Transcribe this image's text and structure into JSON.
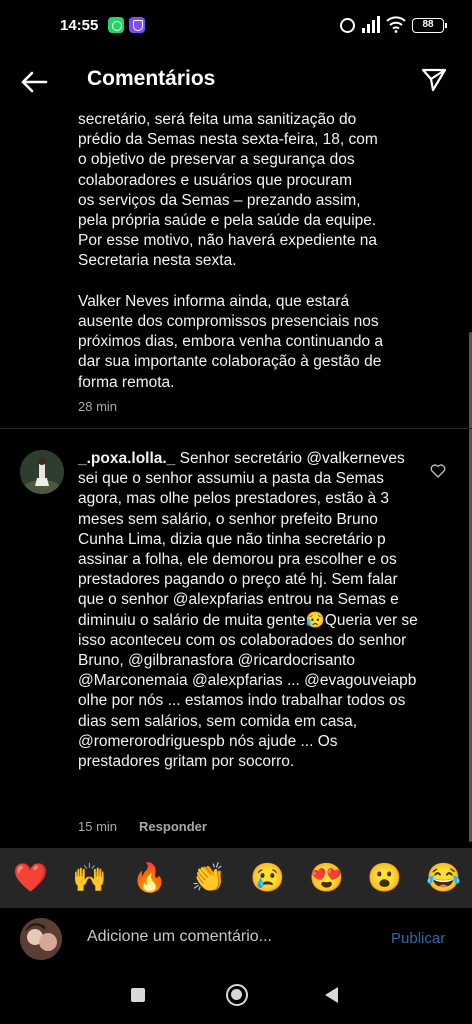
{
  "status_bar": {
    "time": "14:55",
    "battery": "88",
    "icons": [
      "whatsapp-icon",
      "vpn-icon",
      "alarm-icon",
      "signal-icon",
      "wifi-icon",
      "battery-icon"
    ]
  },
  "header": {
    "title": "Comentários",
    "back_icon": "arrow-left-icon",
    "share_icon": "paper-plane-icon"
  },
  "caption": {
    "text": "secretário, será feita uma sanitização do\nprédio da Semas nesta sexta-feira, 18, com\no objetivo de preservar a segurança dos\ncolaboradores e usuários que procuram\nos serviços da Semas – prezando assim,\npela própria saúde e pela saúde da equipe.\nPor esse motivo, não haverá expediente na\nSecretaria nesta sexta.\n\nValker Neves informa ainda, que estará\nausente dos compromissos presenciais nos\npróximos dias, embora venha continuando a\ndar sua importante colaboração à gestão de\nforma remota.",
    "time": "28 min"
  },
  "comment": {
    "username": "_.poxa.lolla._",
    "text": " Senhor secretário @valkerneves sei que o senhor assumiu a pasta da Semas agora, mas olhe pelos prestadores, estão à 3 meses sem salário, o senhor prefeito Bruno Cunha Lima, dizia que não tinha secretário p assinar a folha, ele demorou pra escolher e os prestadores pagando o preço até hj. Sem falar que o senhor @alexpfarias entrou na Semas e diminuiu o salário de muita gente😥Queria ver se isso aconteceu com os colaboradoes do senhor Bruno, @gilbranasfora @ricardocrisanto  @Marconemaia @alexpfarias ... @evagouveiapb olhe por nós ... estamos indo trabalhar todos os dias sem salários, sem comida em casa, @romerorodriguespb nós ajude ... Os prestadores gritam por socorro.",
    "time": "15 min",
    "reply_label": "Responder",
    "like_icon": "heart-outline-icon"
  },
  "emoji_bar": [
    "❤️",
    "🙌",
    "🔥",
    "👏",
    "😢",
    "😍",
    "😮",
    "😂"
  ],
  "composer": {
    "placeholder": "Adicione um comentário...",
    "publish_label": "Publicar"
  },
  "nav": {
    "icons": [
      "recents-square-icon",
      "home-circle-icon",
      "back-triangle-icon"
    ]
  }
}
